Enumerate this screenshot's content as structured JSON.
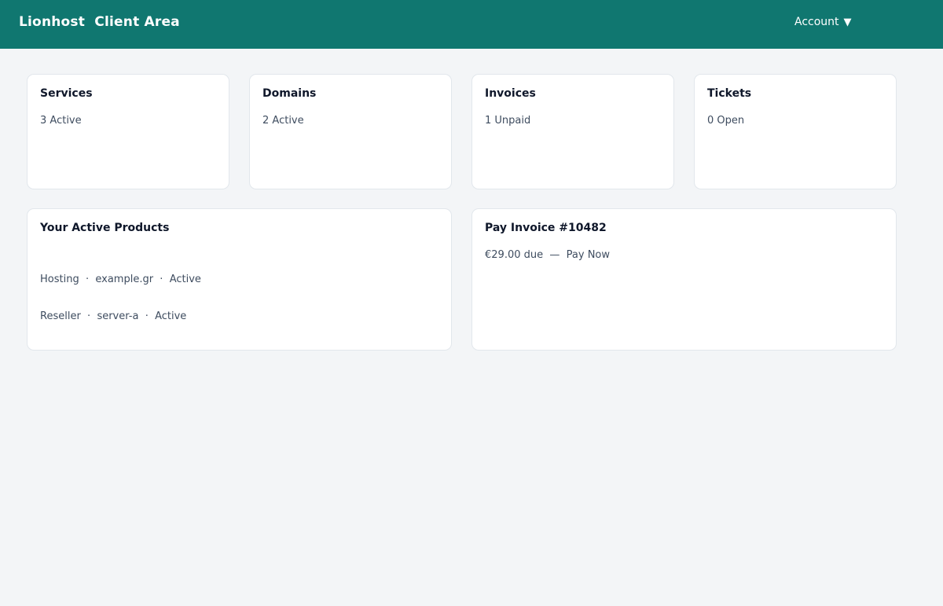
{
  "header": {
    "brand": "Lionhost  Client Area",
    "account_label": "Account",
    "account_caret": "▼"
  },
  "summary": {
    "services": {
      "title": "Services",
      "value": "3 Active"
    },
    "domains": {
      "title": "Domains",
      "value": "2 Active"
    },
    "invoices": {
      "title": "Invoices",
      "value": "1 Unpaid"
    },
    "tickets": {
      "title": "Tickets",
      "value": "0 Open"
    }
  },
  "products": {
    "title": "Your Active Products",
    "rows": [
      "Hosting  ·  example.gr  ·  Active",
      "Reseller  ·  server-a  ·  Active"
    ]
  },
  "pay_invoice": {
    "title": "Pay Invoice #10482",
    "amount": "€29.00 due  —  ",
    "action": "Pay Now"
  },
  "colors": {
    "header_bg": "#107770",
    "page_bg": "#f3f5f7"
  }
}
